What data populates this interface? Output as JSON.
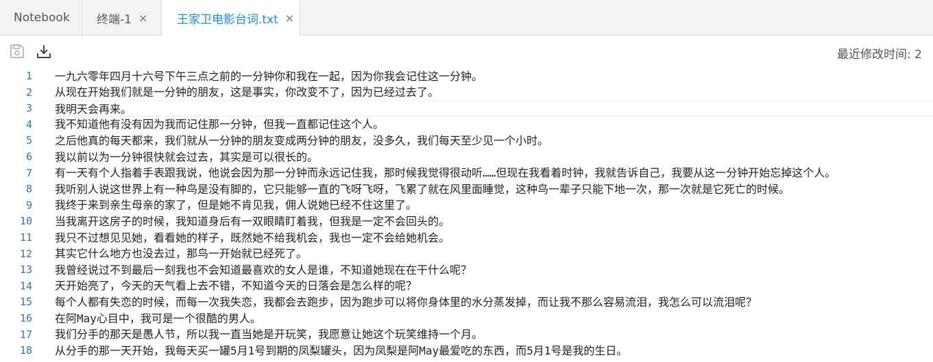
{
  "tabs": [
    {
      "label": "Notebook"
    },
    {
      "label": "终端-1",
      "close": "×"
    },
    {
      "label": "王家卫电影台词.txt",
      "close": "×"
    }
  ],
  "toolbar": {
    "save_icon": "save-icon",
    "download_icon": "download-icon",
    "modified_label": "最近修改时间: 2"
  },
  "editor": {
    "current_line": 3,
    "lines": [
      {
        "no": "1",
        "text": "一九六零年四月十六号下午三点之前的一分钟你和我在一起，因为你我会记住这一分钟。"
      },
      {
        "no": "2",
        "text": "从现在开始我们就是一分钟的朋友，这是事实，你改变不了，因为已经过去了。"
      },
      {
        "no": "3",
        "text": "我明天会再来。"
      },
      {
        "no": "4",
        "text": "我不知道他有没有因为我而记住那一分钟，但我一直都记住这个人。"
      },
      {
        "no": "5",
        "text": "之后他真的每天都来，我们就从一分钟的朋友变成两分钟的朋友，没多久，我们每天至少见一个小时。"
      },
      {
        "no": "6",
        "text": "我以前以为一分钟很快就会过去，其实是可以很长的。"
      },
      {
        "no": "7",
        "text": "有一天有个人指着手表跟我说，他说会因为那一分钟而永远记住我，那时候我觉得很动听……但现在我看着时钟，我就告诉自己，我要从这一分钟开始忘掉这个人。"
      },
      {
        "no": "8",
        "text": "我听别人说这世界上有一种鸟是没有脚的，它只能够一直的飞呀飞呀，飞累了就在风里面睡觉，这种鸟一辈子只能下地一次，那一次就是它死亡的时候。"
      },
      {
        "no": "9",
        "text": "我终于来到亲生母亲的家了，但是她不肯见我，佣人说她已经不住这里了。"
      },
      {
        "no": "10",
        "text": "当我离开这房子的时候，我知道身后有一双眼睛盯着我，但我是一定不会回头的。"
      },
      {
        "no": "11",
        "text": "我只不过想见见她，看看她的样子，既然她不给我机会，我也一定不会给她机会。"
      },
      {
        "no": "12",
        "text": "其实它什么地方也没去过，那鸟一开始就已经死了。"
      },
      {
        "no": "13",
        "text": "我曾经说过不到最后一刻我也不会知道最喜欢的女人是谁，不知道她现在在干什么呢？"
      },
      {
        "no": "14",
        "text": "天开始亮了，今天的天气看上去不错，不知道今天的日落会是怎么样的呢？"
      },
      {
        "no": "15",
        "text": "每个人都有失恋的时候，而每一次我失恋，我都会去跑步，因为跑步可以将你身体里的水分蒸发掉，而让我不那么容易流泪，我怎么可以流泪呢？"
      },
      {
        "no": "16",
        "text": "在阿May心目中，我可是一个很酷的男人。"
      },
      {
        "no": "17",
        "text": "我们分手的那天是愚人节，所以我一直当她是开玩笑，我愿意让她这个玩笑维持一个月。"
      },
      {
        "no": "18",
        "text": "从分手的那一天开始，我每天买一罐5月1号到期的凤梨罐头，因为凤梨是阿May最爱吃的东西，而5月1号是我的生日。"
      }
    ]
  }
}
